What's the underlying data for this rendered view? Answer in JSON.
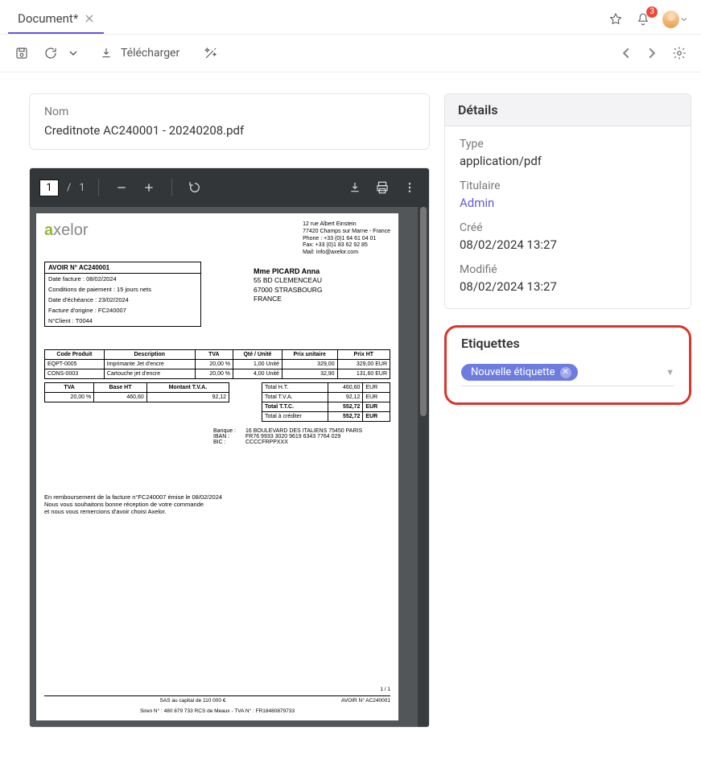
{
  "tab": {
    "title": "Document*"
  },
  "notifications": {
    "count": "3"
  },
  "toolbar": {
    "download": "Télécharger"
  },
  "name_card": {
    "label": "Nom",
    "value": "Creditnote AC240001 - 20240208.pdf"
  },
  "pdfviewer": {
    "page": "1",
    "pages": "1"
  },
  "doc": {
    "logo_a": "a",
    "logo_rest": "xelor",
    "company_addr": [
      "12 rue Albert Einstein",
      "77420 Champs sur Marne - France",
      "Phone : +33 (0)1 64 61 04 01",
      "Fax: +33 (0)1 83 62 92 85",
      "Mail: info@axelor.com"
    ],
    "box_title": "AVOIR N° AC240001",
    "box_rows": [
      "Date facture : 08/02/2024",
      "Conditions de paiement : 15 jours nets",
      "Date d'échéance : 23/02/2024",
      "Facture d'origine : FC240007",
      "N°Client : T0044"
    ],
    "customer": [
      "Mme PICARD Anna",
      "55 BD CLEMENCEAU",
      "67000 STRASBOURG",
      "FRANCE"
    ],
    "tbl_headers": [
      "Code Produit",
      "Description",
      "TVA",
      "Qté / Unité",
      "Prix unitaire",
      "Prix HT"
    ],
    "tbl_rows": [
      [
        "EQPT-0005",
        "Imprimante Jet d'encre",
        "20,00 %",
        "1,00 Unité",
        "329,00",
        "329,00 EUR"
      ],
      [
        "CONS-0003",
        "Cartouche jet d'encre",
        "20,00 %",
        "4,00 Unité",
        "32,90",
        "131,60 EUR"
      ]
    ],
    "tva_headers": [
      "TVA",
      "Base HT",
      "Montant T.V.A."
    ],
    "tva_row": [
      "20,00 %",
      "460,60",
      "92,12"
    ],
    "totals": [
      [
        "Total H.T.",
        "460,60",
        "EUR"
      ],
      [
        "Total T.V.A.",
        "92,12",
        "EUR"
      ],
      [
        "Total T.T.C.",
        "552,72",
        "EUR"
      ],
      [
        "Total à créditer",
        "552,72",
        "EUR"
      ]
    ],
    "bank": [
      [
        "Banque :",
        "16 BOULEVARD DES ITALIENS 75450 PARIS"
      ],
      [
        "IBAN :",
        "FR76 9933 3020 9619 6343 7764 029"
      ],
      [
        "BIC :",
        "CCCCFRPPXXX"
      ]
    ],
    "note1": "En remboursement de la facture n°FC240007  émise le  08/02/2024",
    "note2": "Nous vous souhaitons bonne réception de votre commande",
    "note3": "et nous vous remercions d'avoir choisi Axelor.",
    "foot_center": "SAS au capital de 110 000 €",
    "foot_pg": "1   /   1",
    "foot_ref": "AVOIR N°  AC240001",
    "foot_siren": "Siren N° : 480 879 733 RCS de Meaux - TVA N° : FR18480879733"
  },
  "details": {
    "title": "Détails",
    "type_label": "Type",
    "type_value": "application/pdf",
    "owner_label": "Titulaire",
    "owner_value": "Admin",
    "created_label": "Créé",
    "created_value": "08/02/2024 13:27",
    "modified_label": "Modifié",
    "modified_value": "08/02/2024 13:27"
  },
  "tags": {
    "title": "Etiquettes",
    "tag": "Nouvelle étiquette"
  }
}
